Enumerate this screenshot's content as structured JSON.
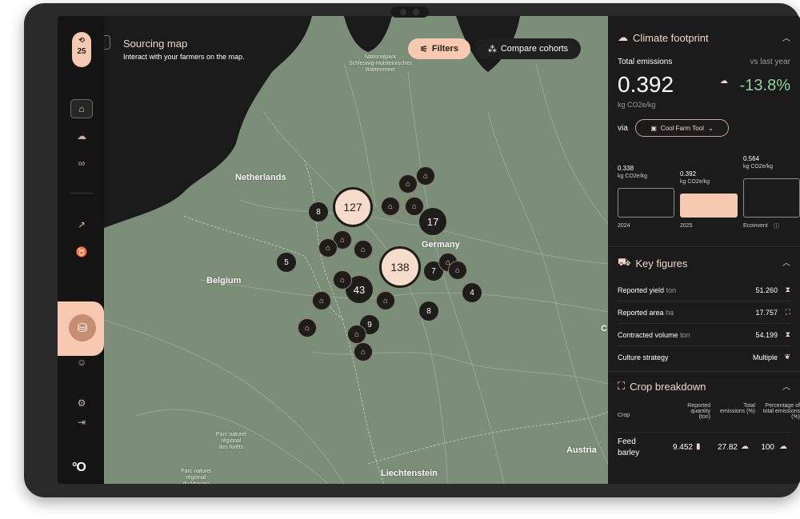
{
  "sidebar": {
    "year": "25",
    "items": [
      "home",
      "cloud",
      "link",
      "trend",
      "cow",
      "account",
      "settings",
      "logout"
    ]
  },
  "map": {
    "title": "Sourcing map",
    "subtitle": "Interact with your farmers on the map.",
    "filters_label": "Filters",
    "compare_label": "Compare cohorts",
    "labels": {
      "netherlands": "Netherlands",
      "belgium": "Belgium",
      "germany": "Germany",
      "austria": "Austria",
      "liechtenstein": "Liechtenstein",
      "nationalpark": "Nationalpark\nSchleswig-Holsteinisches\nWattenmeer",
      "foret": "Parc naturel\nrégional\ndes forêts",
      "morvan": "Parc naturel\nrégional\ndu Morvan",
      "partial_c": "C"
    },
    "clusters": [
      {
        "id": "c127",
        "value": "127"
      },
      {
        "id": "c138",
        "value": "138"
      },
      {
        "id": "c43",
        "value": "43"
      },
      {
        "id": "c17",
        "value": "17"
      },
      {
        "id": "c8a",
        "value": "8"
      },
      {
        "id": "c5",
        "value": "5"
      },
      {
        "id": "c7",
        "value": "7"
      },
      {
        "id": "c4",
        "value": "4"
      },
      {
        "id": "c8b",
        "value": "8"
      },
      {
        "id": "c9",
        "value": "9"
      }
    ]
  },
  "climate": {
    "title": "Climate footprint",
    "total_label": "Total emissions",
    "vs_label": "vs last year",
    "value": "0.392",
    "unit": "kg CO2e/kg",
    "delta": "-13.8%",
    "via_label": "via",
    "tool": "Cool Farm Tool",
    "bars": [
      {
        "label": "2024",
        "value": "0.338",
        "unit": "kg CO2e/kg"
      },
      {
        "label": "2025",
        "value": "0.392",
        "unit": "kg CO2e/kg"
      },
      {
        "label": "Ecoinvent",
        "value": "0.564",
        "unit": "kg CO2e/kg"
      }
    ]
  },
  "key_figures": {
    "title": "Key figures",
    "rows": [
      {
        "label": "Reported yield",
        "unit": "ton",
        "value": "51.260"
      },
      {
        "label": "Reported area",
        "unit": "ha",
        "value": "17.757"
      },
      {
        "label": "Contracted volume",
        "unit": "ton",
        "value": "54.199"
      },
      {
        "label": "Culture strategy",
        "unit": "",
        "value": "Multiple"
      }
    ]
  },
  "crop": {
    "title": "Crop breakdown",
    "headers": [
      "Crop",
      "Reported quantity (ton)",
      "Total emissions (%)",
      "Percentage of total emissions (%)"
    ],
    "row": {
      "crop": "Feed barley",
      "quantity": "9.452",
      "emissions": "27.82",
      "percent": "100"
    }
  },
  "colors": {
    "accent": "#f7c9b0",
    "positive": "#8fd19b",
    "map": "#7b8f78",
    "panel": "#1b1b1b"
  }
}
